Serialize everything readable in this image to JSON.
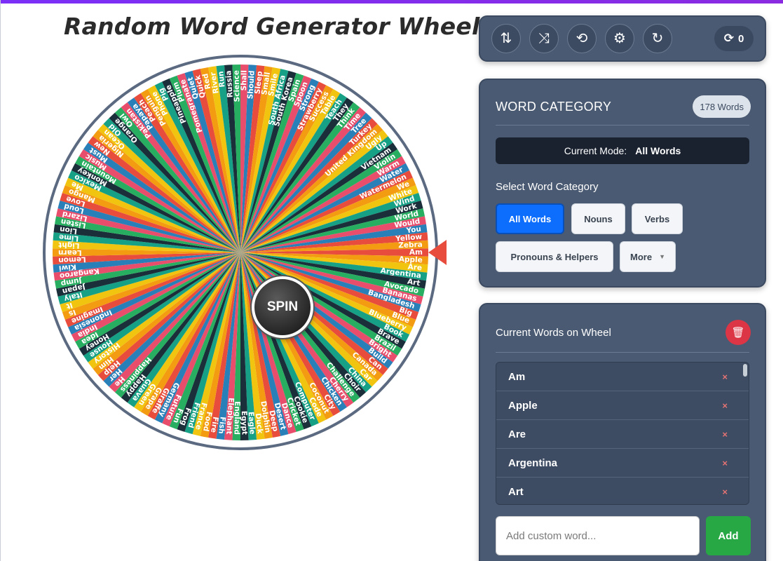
{
  "page": {
    "title": "Random Word Generator Wheel"
  },
  "wheel": {
    "spin_label": "SPIN",
    "colors": [
      "#e74c3c",
      "#f39c12",
      "#f1c40f",
      "#16a085",
      "#1a2f3a",
      "#27ae60",
      "#e84e6b",
      "#2980b9"
    ],
    "words": [
      "Am",
      "Apple",
      "Are",
      "Argentina",
      "Art",
      "Avocado",
      "Bananas",
      "Bangladesh",
      "Big",
      "Blue",
      "Blueberry",
      "Book",
      "Brave",
      "Brazil",
      "Bright",
      "Build",
      "Can",
      "Canada",
      "Car",
      "China",
      "Choir",
      "Challenge",
      "Cherry",
      "Chicken",
      "City",
      "Coconut",
      "Code",
      "Computer",
      "Cookie",
      "Cricket",
      "Dance",
      "Desert",
      "Deep",
      "Dolphin",
      "Duck",
      "Eagle",
      "Egypt",
      "England",
      "Elephant",
      "Fish",
      "Fire",
      "Food",
      "France",
      "Friend",
      "Frog",
      "Fun",
      "Future",
      "Germany",
      "Giraffe",
      "Grape",
      "Green",
      "Guava",
      "Happy",
      "Happiness",
      "He",
      "Her",
      "Help",
      "Him",
      "History",
      "House",
      "Honey",
      "Idea",
      "India",
      "Indonesia",
      "Imagine",
      "Is",
      "It",
      "Italy",
      "Japan",
      "Jump",
      "Kangaroo",
      "Kiwi",
      "Lemon",
      "Learn",
      "Light",
      "Lime",
      "Lion",
      "Listen",
      "Lizard",
      "Loud",
      "Love",
      "Mango",
      "Me",
      "Mexico",
      "Monkey",
      "Mountain",
      "Music",
      "Must",
      "New",
      "Nigeria",
      "Ocean",
      "Old",
      "Orange",
      "Owl",
      "Pakistan",
      "Papaya",
      "Peach",
      "Penguin",
      "Phone",
      "Pig",
      "Pineapple",
      "Plum",
      "Pomegranate",
      "Quiet",
      "Quick",
      "Red",
      "River",
      "Run",
      "Russia",
      "Science",
      "Shall",
      "Should",
      "Sleep",
      "Small",
      "Smile",
      "South Africa",
      "South Korea",
      "Spain",
      "Spoon",
      "Strong",
      "Strawberry",
      "Success",
      "Table",
      "Teach",
      "They",
      "Think",
      "Time",
      "Tree",
      "Turkey",
      "United Kingdom",
      "Ugly",
      "Up",
      "Vietnam",
      "Violin",
      "Warm",
      "Water",
      "Watermelon",
      "We",
      "White",
      "Wind",
      "Work",
      "World",
      "Would",
      "You",
      "Yellow",
      "Zebra"
    ]
  },
  "toolbar": {
    "buttons": [
      {
        "name": "sort-button",
        "icon": "sort-icon",
        "glyph": "⇅"
      },
      {
        "name": "shuffle-button",
        "icon": "shuffle-icon",
        "glyph": "⤨"
      },
      {
        "name": "history-button",
        "icon": "history-icon",
        "glyph": "⟲"
      },
      {
        "name": "settings-button",
        "icon": "gear-icon",
        "glyph": "⚙"
      },
      {
        "name": "reset-button",
        "icon": "redo-icon",
        "glyph": "↻"
      }
    ],
    "spin_count": "0",
    "counter_glyph": "⟳"
  },
  "category": {
    "heading": "WORD CATEGORY",
    "word_count": "178 Words",
    "mode_label": "Current Mode:",
    "mode_value": "All Words",
    "select_label": "Select Word Category",
    "chips": [
      "All Words",
      "Nouns",
      "Verbs",
      "Pronouns & Helpers",
      "More"
    ],
    "active_chip": "All Words"
  },
  "words_panel": {
    "heading": "Current Words on Wheel",
    "items": [
      "Am",
      "Apple",
      "Are",
      "Argentina",
      "Art"
    ],
    "remove_glyph": "×",
    "input_placeholder": "Add custom word...",
    "add_label": "Add"
  }
}
